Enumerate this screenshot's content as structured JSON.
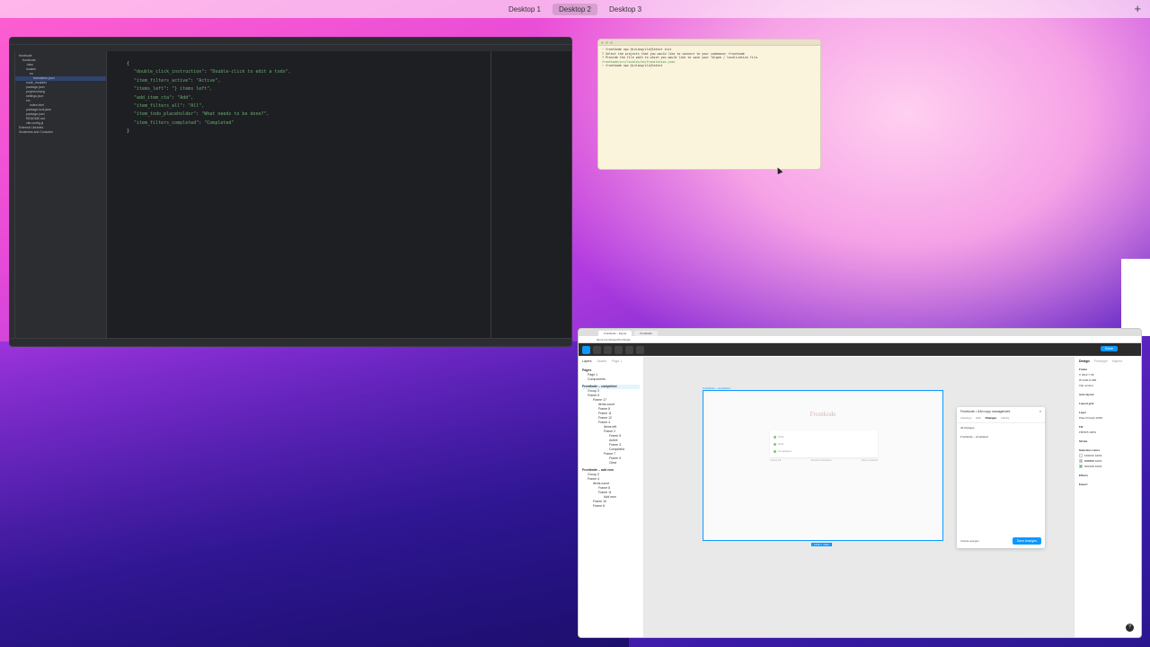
{
  "spaces": {
    "items": [
      {
        "label": "Desktop 1"
      },
      {
        "label": "Desktop 2"
      },
      {
        "label": "Desktop 3"
      }
    ],
    "add_label": "+"
  },
  "ide": {
    "tree": [
      "frontkode",
      "frontkode",
      ".idea",
      "locales",
      "en",
      "translation.json",
      "node_modules",
      "package.json",
      "project.inlang",
      "settings.json",
      "src",
      "index.html",
      "package-lock.json",
      "package.json",
      "README.md",
      "vite.config.js",
      "External Libraries",
      "Scratches and Consoles"
    ],
    "code_lines": [
      {
        "text": "{"
      },
      {
        "key": "\"double_click_instruction\"",
        "val": "\"Double-click to edit a todo\","
      },
      {
        "key": "\"item_filters_active\"",
        "val": "\"Active\","
      },
      {
        "key": "\"items_left\"",
        "val": "\"} items left\","
      },
      {
        "key": "\"add_item_cta\"",
        "val": "\"Add\","
      },
      {
        "key": "\"item_filters_all\"",
        "val": "\"All\","
      },
      {
        "key": "\"item_todo_placeholder\"",
        "val": "\"What needs to be done?\","
      },
      {
        "key": "\"item_filters_completed\"",
        "val": "\"Completed\""
      },
      {
        "text": "}"
      }
    ]
  },
  "terminal": {
    "lines": [
      "~ frontkode npx @inlang/cli@latest init",
      "? Select the projects that you would like to connect to your codebase: frontkode",
      "? Provide the file path to which you would like to save your Tolgee / localization file.",
      "frontkode/src/locales/en/translation.json",
      "~ frontkode npx @inlang/cli@latest"
    ]
  },
  "figma": {
    "tabs": [
      "Frontkode – Figma",
      "Frontkode"
    ],
    "url": "figma.com/design/Frontkode",
    "share_label": "Share",
    "left": {
      "tab_layers": "Layers",
      "tab_assets": "Assets",
      "page_label": "Page 1",
      "pages_header": "Pages",
      "pages": [
        "Page 1",
        "Components"
      ],
      "layers": [
        {
          "label": "Frontkode – completed",
          "cls": "sec sel"
        },
        {
          "label": "Group 3",
          "cls": "ind1"
        },
        {
          "label": "Frame 6",
          "cls": "ind1"
        },
        {
          "label": "Frame 17",
          "cls": "ind2"
        },
        {
          "label": "items-count",
          "cls": "ind3"
        },
        {
          "label": "Frame 8",
          "cls": "ind3"
        },
        {
          "label": "Frame 11",
          "cls": "ind3"
        },
        {
          "label": "Frame 12",
          "cls": "ind3"
        },
        {
          "label": "Frame 4",
          "cls": "ind3"
        },
        {
          "label": "Items left",
          "cls": "ind4"
        },
        {
          "label": "Frame 2",
          "cls": "ind4"
        },
        {
          "label": "Frame 5",
          "cls": "ind5"
        },
        {
          "label": "Active",
          "cls": "ind5"
        },
        {
          "label": "Frame 3",
          "cls": "ind5"
        },
        {
          "label": "Completed",
          "cls": "ind5"
        },
        {
          "label": "Frame 7",
          "cls": "ind4"
        },
        {
          "label": "Frame 9",
          "cls": "ind5"
        },
        {
          "label": "Clear",
          "cls": "ind5"
        },
        {
          "label": "Frontkode – add new",
          "cls": "sec"
        },
        {
          "label": "Group 3",
          "cls": "ind1"
        },
        {
          "label": "Frame 4",
          "cls": "ind1"
        },
        {
          "label": "items-count",
          "cls": "ind2"
        },
        {
          "label": "Frame 8",
          "cls": "ind3"
        },
        {
          "label": "Frame 11",
          "cls": "ind3"
        },
        {
          "label": "Add new",
          "cls": "ind4"
        },
        {
          "label": "Frame 10",
          "cls": "ind2"
        },
        {
          "label": "Frame 6",
          "cls": "ind2"
        }
      ]
    },
    "canvas": {
      "frame_label": "Frontkode – completed",
      "frame_title": "Frontkode",
      "todo_rows": [
        "Todo",
        "Todo",
        "Completed"
      ],
      "foot": [
        "2 items left",
        "All  Active  Completed",
        "Clear completed"
      ],
      "size_badge": "1440 × 1024"
    },
    "plugin": {
      "title": "Frontkode • i18n copy management",
      "close": "×",
      "tabs": [
        "Inventory",
        "Edit",
        "Changes",
        "Library"
      ],
      "active_tab": "Changes",
      "section": "All changes",
      "row": "Frontkode – completed",
      "footer_check": "Include assigns",
      "footer_btn": "Save changes"
    },
    "right": {
      "tabs": [
        "Design",
        "Prototype",
        "Inspect"
      ],
      "props": [
        {
          "label": "Frame",
          "cls": "sec"
        },
        {
          "label": "X  3312        Y  96"
        },
        {
          "label": "W  1440       H  960"
        },
        {
          "label": "Clip content"
        },
        {
          "label": "Auto layout",
          "cls": "sec"
        },
        {
          "label": "Layout grid",
          "cls": "sec"
        },
        {
          "label": "Layer",
          "cls": "sec"
        },
        {
          "label": "Pass through    100%"
        },
        {
          "label": "Fill",
          "cls": "sec"
        },
        {
          "label": "F5F5F5     100%"
        },
        {
          "label": "Stroke",
          "cls": "sec"
        },
        {
          "label": "Selection colors",
          "cls": "sec"
        },
        {
          "label": "FFFFFF     100%",
          "swatch": "#ffffff"
        },
        {
          "label": "B8B8B8     100%",
          "swatch": "#b8b8b8"
        },
        {
          "label": "5DC165     100%",
          "swatch": "#5dc165"
        },
        {
          "label": "Effects",
          "cls": "sec"
        },
        {
          "label": "Export",
          "cls": "sec"
        }
      ]
    },
    "help_label": "?"
  },
  "colors": {
    "figma_blue": "#0d99ff",
    "ide_bg": "#1e1f22",
    "terminal_bg": "#fbf4dd"
  }
}
